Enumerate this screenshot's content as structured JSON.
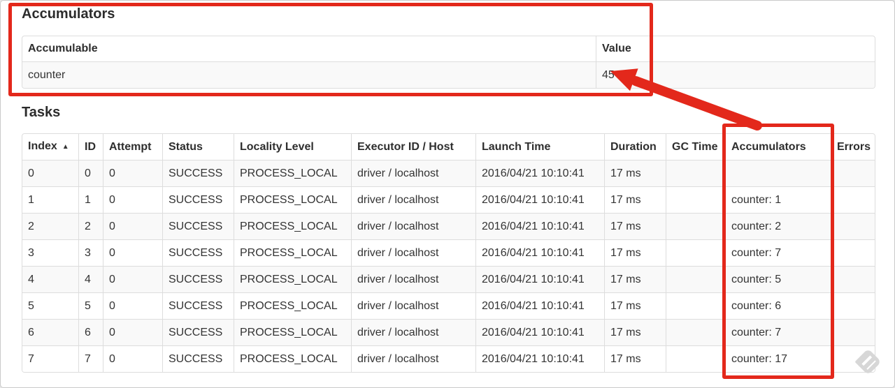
{
  "accumulators": {
    "title": "Accumulators",
    "table": {
      "headers": [
        "Accumulable",
        "Value"
      ],
      "rows": [
        {
          "name": "counter",
          "value": "45"
        }
      ]
    }
  },
  "tasks": {
    "title": "Tasks",
    "table": {
      "sort_icon": "▲",
      "columns": [
        {
          "key": "index",
          "label": "Index"
        },
        {
          "key": "id",
          "label": "ID"
        },
        {
          "key": "attempt",
          "label": "Attempt"
        },
        {
          "key": "status",
          "label": "Status"
        },
        {
          "key": "locality_level",
          "label": "Locality Level"
        },
        {
          "key": "executor",
          "label": "Executor ID / Host"
        },
        {
          "key": "launch_time",
          "label": "Launch Time"
        },
        {
          "key": "duration",
          "label": "Duration"
        },
        {
          "key": "gc_time",
          "label": "GC Time"
        },
        {
          "key": "accumulators",
          "label": "Accumulators"
        },
        {
          "key": "errors",
          "label": "Errors"
        }
      ],
      "rows": [
        {
          "index": "0",
          "id": "0",
          "attempt": "0",
          "status": "SUCCESS",
          "locality_level": "PROCESS_LOCAL",
          "executor": "driver / localhost",
          "launch_time": "2016/04/21 10:10:41",
          "duration": "17 ms",
          "gc_time": "",
          "accumulators": "",
          "errors": ""
        },
        {
          "index": "1",
          "id": "1",
          "attempt": "0",
          "status": "SUCCESS",
          "locality_level": "PROCESS_LOCAL",
          "executor": "driver / localhost",
          "launch_time": "2016/04/21 10:10:41",
          "duration": "17 ms",
          "gc_time": "",
          "accumulators": "counter: 1",
          "errors": ""
        },
        {
          "index": "2",
          "id": "2",
          "attempt": "0",
          "status": "SUCCESS",
          "locality_level": "PROCESS_LOCAL",
          "executor": "driver / localhost",
          "launch_time": "2016/04/21 10:10:41",
          "duration": "17 ms",
          "gc_time": "",
          "accumulators": "counter: 2",
          "errors": ""
        },
        {
          "index": "3",
          "id": "3",
          "attempt": "0",
          "status": "SUCCESS",
          "locality_level": "PROCESS_LOCAL",
          "executor": "driver / localhost",
          "launch_time": "2016/04/21 10:10:41",
          "duration": "17 ms",
          "gc_time": "",
          "accumulators": "counter: 7",
          "errors": ""
        },
        {
          "index": "4",
          "id": "4",
          "attempt": "0",
          "status": "SUCCESS",
          "locality_level": "PROCESS_LOCAL",
          "executor": "driver / localhost",
          "launch_time": "2016/04/21 10:10:41",
          "duration": "17 ms",
          "gc_time": "",
          "accumulators": "counter: 5",
          "errors": ""
        },
        {
          "index": "5",
          "id": "5",
          "attempt": "0",
          "status": "SUCCESS",
          "locality_level": "PROCESS_LOCAL",
          "executor": "driver / localhost",
          "launch_time": "2016/04/21 10:10:41",
          "duration": "17 ms",
          "gc_time": "",
          "accumulators": "counter: 6",
          "errors": ""
        },
        {
          "index": "6",
          "id": "6",
          "attempt": "0",
          "status": "SUCCESS",
          "locality_level": "PROCESS_LOCAL",
          "executor": "driver / localhost",
          "launch_time": "2016/04/21 10:10:41",
          "duration": "17 ms",
          "gc_time": "",
          "accumulators": "counter: 7",
          "errors": ""
        },
        {
          "index": "7",
          "id": "7",
          "attempt": "0",
          "status": "SUCCESS",
          "locality_level": "PROCESS_LOCAL",
          "executor": "driver / localhost",
          "launch_time": "2016/04/21 10:10:41",
          "duration": "17 ms",
          "gc_time": "",
          "accumulators": "counter: 17",
          "errors": ""
        }
      ]
    }
  },
  "annotations": {
    "color": "#e3281b"
  }
}
